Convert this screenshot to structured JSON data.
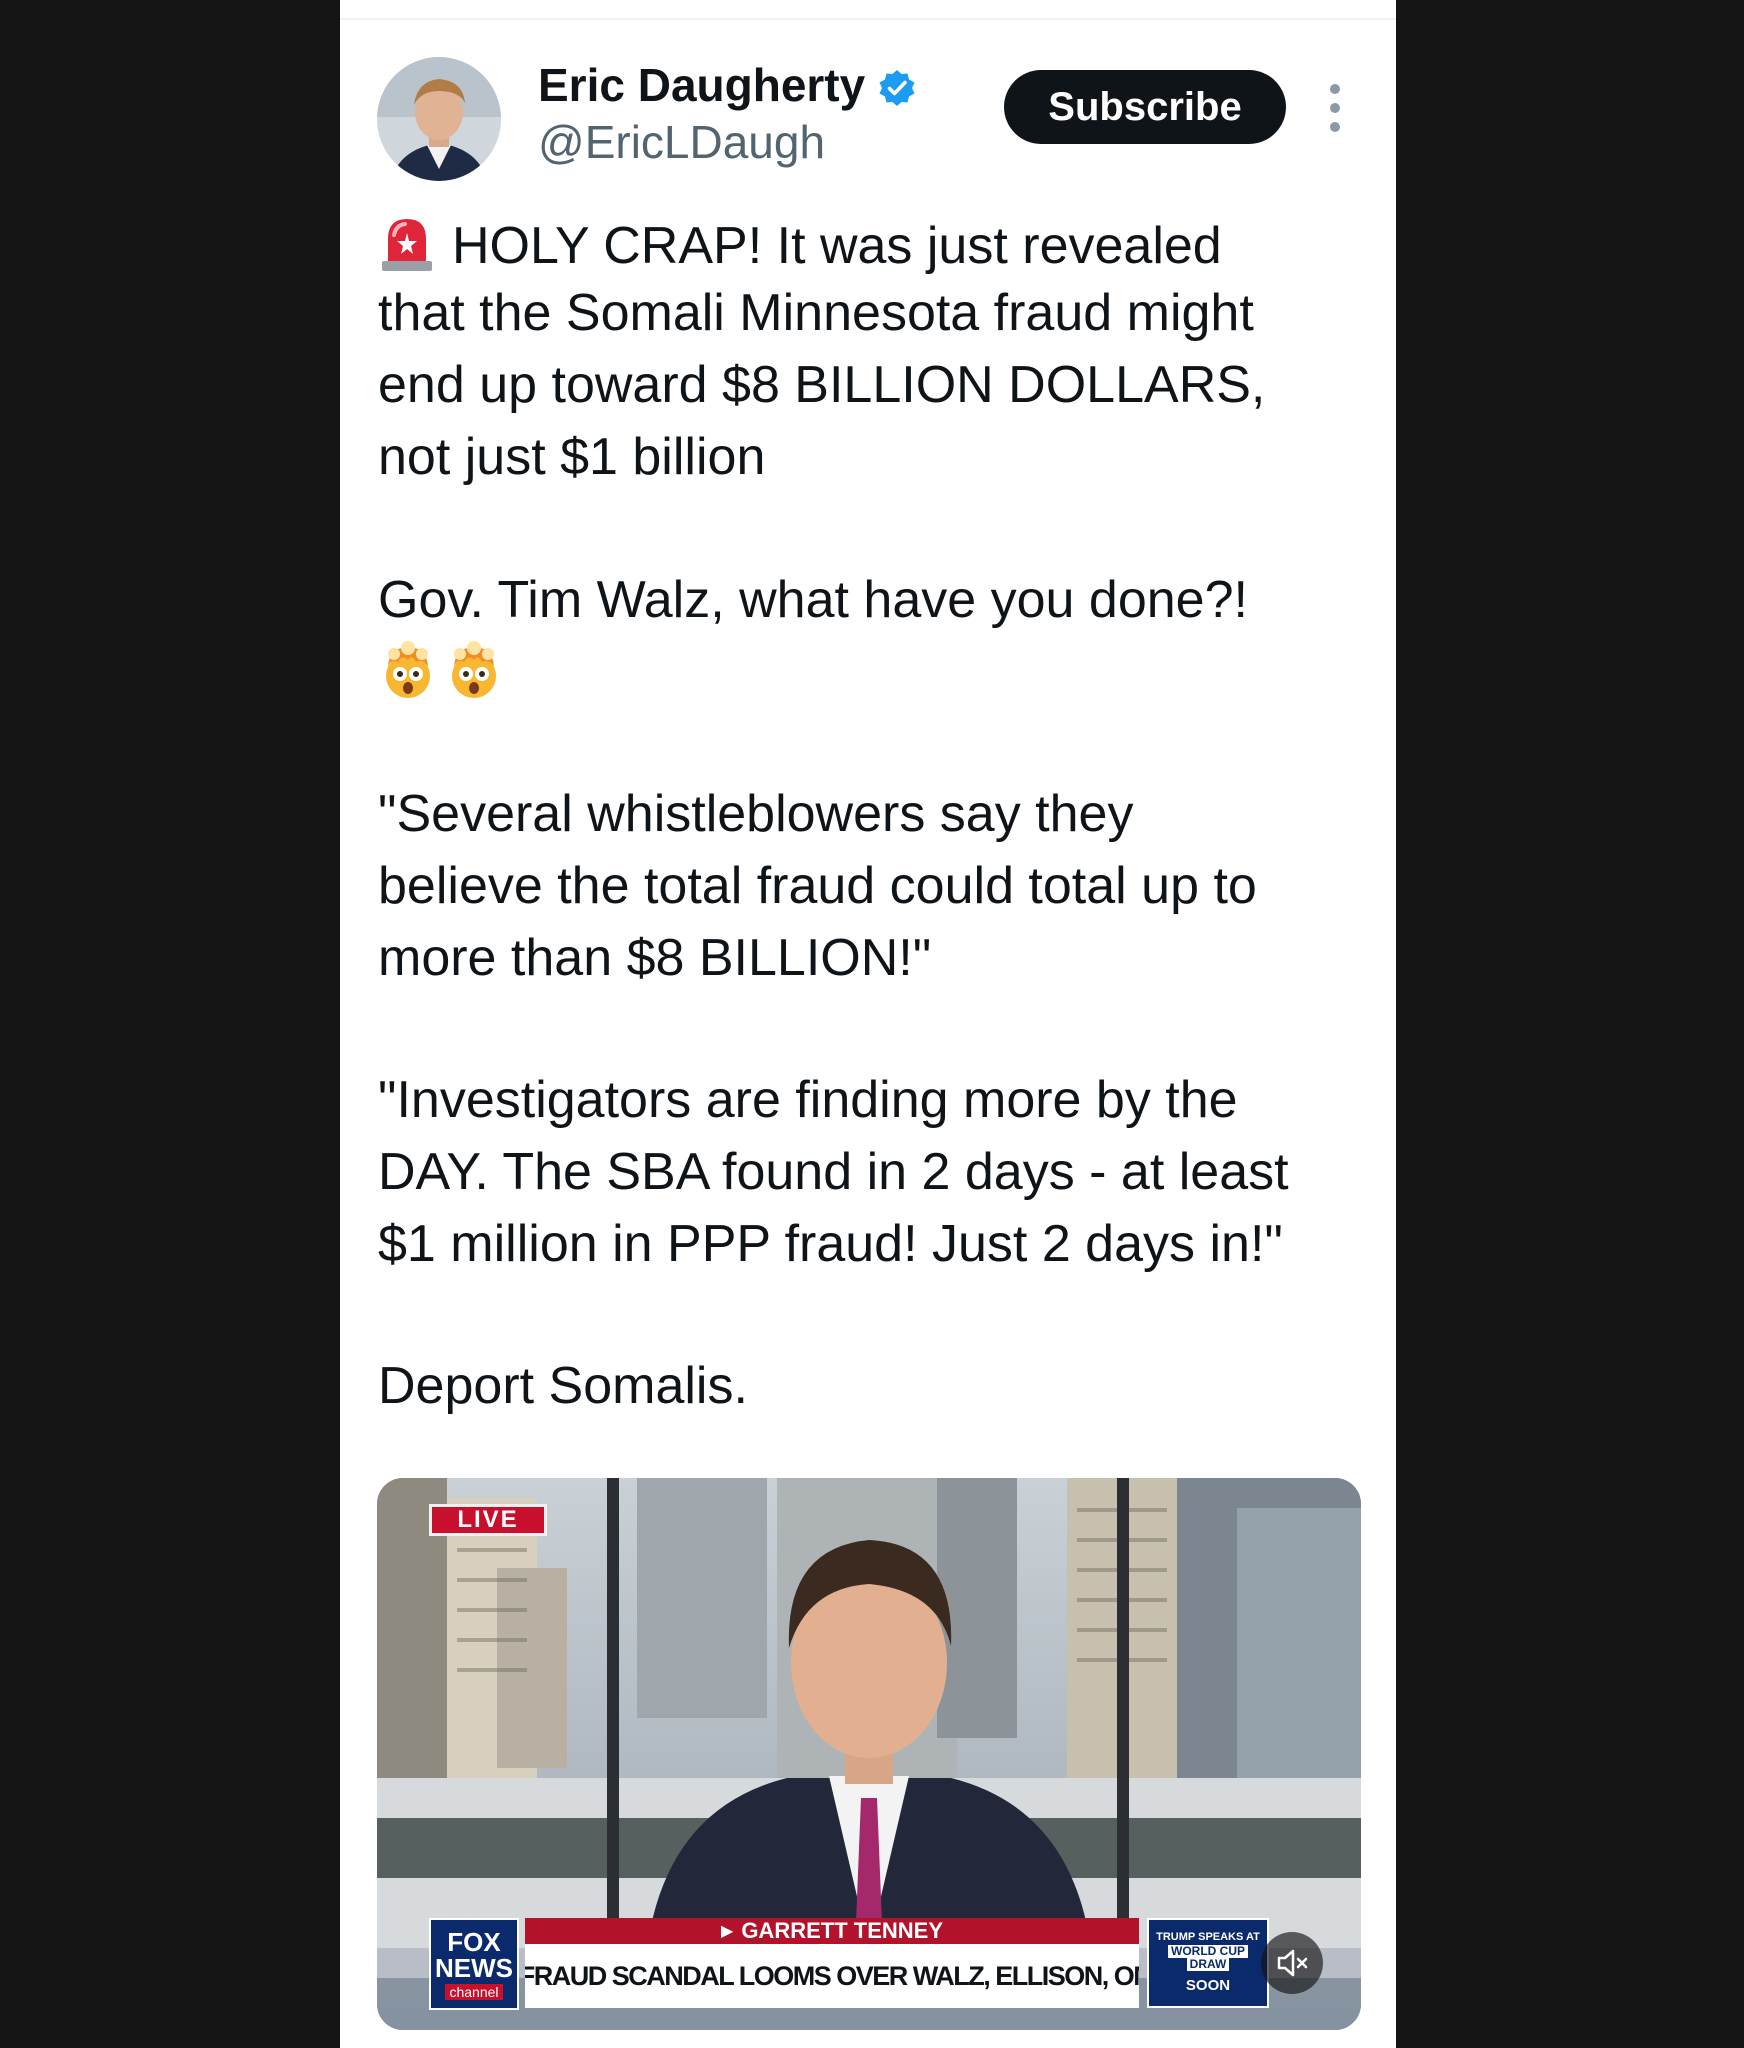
{
  "tweet": {
    "author": {
      "display_name": "Eric Daugherty",
      "handle": "@EricLDaugh",
      "verified_icon": "verified-badge-icon"
    },
    "subscribe_label": "Subscribe",
    "text_lines": [
      "HOLY CRAP! It was just revealed",
      "that the Somali Minnesota fraud might",
      "end up toward $8 BILLION DOLLARS,",
      "not just $1 billion",
      "Gov. Tim Walz, what have you done?!",
      "\"Several whistleblowers say they",
      "believe the total fraud could total up to",
      "more than $8 BILLION!\"",
      "\"Investigators are finding more by the",
      "DAY. The SBA found in 2 days - at least",
      "$1 million in PPP fraud! Just 2 days in!\"",
      "Deport Somalis."
    ]
  },
  "video": {
    "live_label": "LIVE",
    "network_logo": [
      "FOX",
      "NEWS",
      "channel"
    ],
    "reporter_name": "GARRETT TENNEY",
    "headline": "MN FRAUD SCANDAL LOOMS OVER WALZ, ELLISON, OMAR",
    "promo_lines": [
      "TRUMP SPEAKS AT",
      "WORLD CUP",
      "DRAW",
      "SOON"
    ],
    "mute_icon": "mute-icon"
  },
  "colors": {
    "verified": "#1d9bf0",
    "subscribe_bg": "#0f1419",
    "live_red": "#c8102e",
    "fox_navy": "#0a2a6b"
  }
}
